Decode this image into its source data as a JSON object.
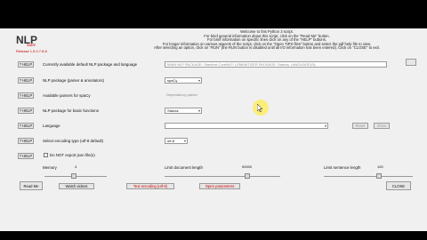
{
  "logo": {
    "title": "NLP",
    "subtitle": "Suite",
    "release": "Release 1.5.0.7.8.8"
  },
  "intro": [
    "Welcome to this Python 3 script.",
    "For brief general information about this script, click on the \"Read Me\" button.",
    "For brief information on specific lines click on any of the \"HELP\" buttons.",
    "For longer information on various aspects of the script, click on the \"Open TIPS files\" button and select the pdf help file to view.",
    "After selecting an option, click on \"RUN\" (the RUN button is disabled until all I/O information has been entered).   Click on \"CLOSE\" to exit."
  ],
  "help_label": "? HELP",
  "rows": [
    {
      "label": "Currently available default NLP package and language",
      "value": "MAIN NLP PACKAGE: Stanford CoreNLP; LEMMATIZER PACKAGE: Stanza; LANGUAGE(S): "
    },
    {
      "label": "NLP package (parser & annotators)",
      "value": "spaCy"
    },
    {
      "label": "Available parsers for spaCy",
      "value": "Dependency parser"
    },
    {
      "label": "NLP package for basic functions",
      "value": "Stanza"
    },
    {
      "label": "Language",
      "value": ""
    },
    {
      "label": "Select encoding type (utf-8 default)",
      "value": "utf-8"
    },
    {
      "label": "Do NOT export json file(s)",
      "value": ""
    }
  ],
  "buttons": {
    "reset": "Reset",
    "show": "Show",
    "read_me": "Read Me",
    "close": "CLOSE"
  },
  "sliders": {
    "memory": {
      "label": "Memory",
      "value": "4"
    },
    "doc_length": {
      "label": "Limit document length",
      "value": "90000"
    },
    "sentence_length": {
      "label": "Limit sentence length",
      "value": "100"
    }
  },
  "bottom_links": {
    "videos": "Watch videos",
    "encoding": "Text encoding (utf-8)",
    "parameters": "Open parameters"
  }
}
